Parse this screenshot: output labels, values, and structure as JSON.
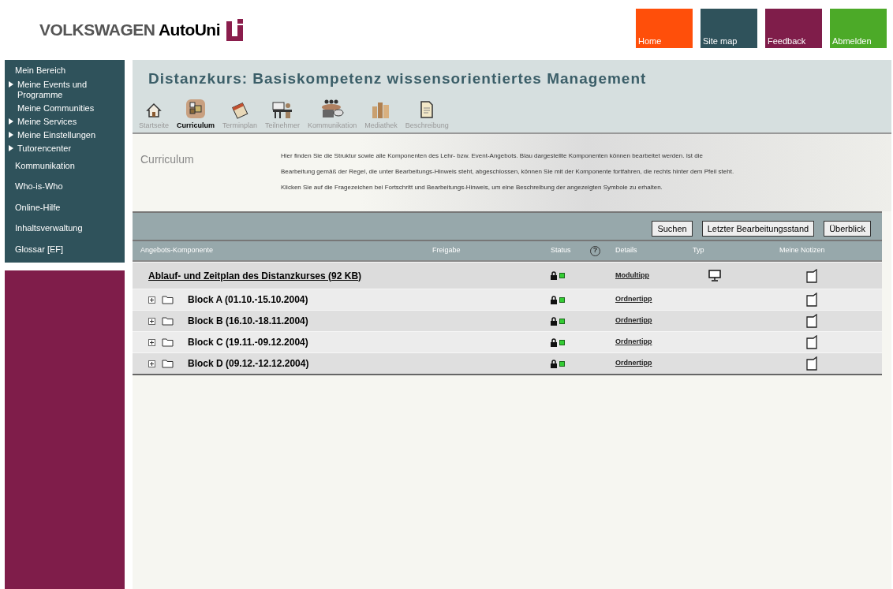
{
  "logo": {
    "brand": "VOLKSWAGEN",
    "product": "AutoUni"
  },
  "top_nav": [
    {
      "label": "Home",
      "color": "#ff4f0a"
    },
    {
      "label": "Site map",
      "color": "#2f525b"
    },
    {
      "label": "Feedback",
      "color": "#7f1d4a"
    },
    {
      "label": "Abmelden",
      "color": "#4caa28"
    }
  ],
  "sidebar": {
    "items": [
      {
        "label": "Mein Bereich",
        "kind": "heading"
      },
      {
        "label": "Meine Events und Programme",
        "kind": "sub",
        "arrow": true
      },
      {
        "label": "Meine Communities",
        "kind": "sub",
        "arrow": false
      },
      {
        "label": "Meine Services",
        "kind": "sub",
        "arrow": true
      },
      {
        "label": "Meine Einstellungen",
        "kind": "sub",
        "arrow": true
      },
      {
        "label": "Tutorencenter",
        "kind": "sub",
        "arrow": true
      },
      {
        "label": "Kommunikation",
        "kind": "link"
      },
      {
        "label": "Who-is-Who",
        "kind": "link"
      },
      {
        "label": "Online-Hilfe",
        "kind": "link"
      },
      {
        "label": "Inhaltsverwaltung",
        "kind": "link"
      },
      {
        "label": "Glossar [EF]",
        "kind": "link"
      }
    ]
  },
  "course_title": "Distanzkurs: Basiskompetenz wissensorientiertes Management",
  "tabs": [
    {
      "label": "Startseite",
      "kind": "home",
      "selected": false
    },
    {
      "label": "Curriculum",
      "kind": "curriculum",
      "selected": true
    },
    {
      "label": "Terminplan",
      "kind": "calendar",
      "selected": false
    },
    {
      "label": "Teilnehmer",
      "kind": "people",
      "selected": false
    },
    {
      "label": "Kommunikation",
      "kind": "meeting",
      "selected": false
    },
    {
      "label": "Mediathek",
      "kind": "books",
      "selected": false
    },
    {
      "label": "Beschreibung",
      "kind": "document",
      "selected": false
    }
  ],
  "section": {
    "title": "Curriculum",
    "description": [
      "Hier finden Sie die Struktur sowie alle Komponenten des Lehr- bzw. Event-Angebots. Blau dargestellte Komponenten können bearbeitet werden. Ist die",
      "Bearbeitung gemäß der Regel, die unter Bearbeitungs-Hinweis steht, abgeschlossen, können Sie mit der Komponente fortfahren, die rechts hinter dem Pfeil steht.",
      "Klicken Sie auf die Fragezeichen bei Fortschritt und Bearbeitungs-Hinweis, um eine Beschreibung der angezeigten Symbole zu erhalten."
    ]
  },
  "buttons": [
    "Suchen",
    "Letzter Bearbeitungsstand",
    "Überblick"
  ],
  "table": {
    "columns": [
      "Angebots-Komponente",
      "Freigabe",
      "Status",
      "?",
      "Details",
      "Typ",
      "Meine Notizen"
    ],
    "rows": [
      {
        "kind": "module",
        "name": "Ablauf- und Zeitplan des Distanzkurses (92 KB)",
        "details": "Modultipp",
        "typ_icon": true
      },
      {
        "kind": "folder",
        "name": "Block A (01.10.-15.10.2004)",
        "details": "Ordnertipp",
        "typ_icon": false
      },
      {
        "kind": "folder",
        "name": "Block B (16.10.-18.11.2004)",
        "details": "Ordnertipp",
        "typ_icon": false
      },
      {
        "kind": "folder",
        "name": "Block C (19.11.-09.12.2004)",
        "details": "Ordnertipp",
        "typ_icon": false
      },
      {
        "kind": "folder",
        "name": "Block D (09.12.-12.12.2004)",
        "details": "Ordnertipp",
        "typ_icon": false
      }
    ]
  }
}
